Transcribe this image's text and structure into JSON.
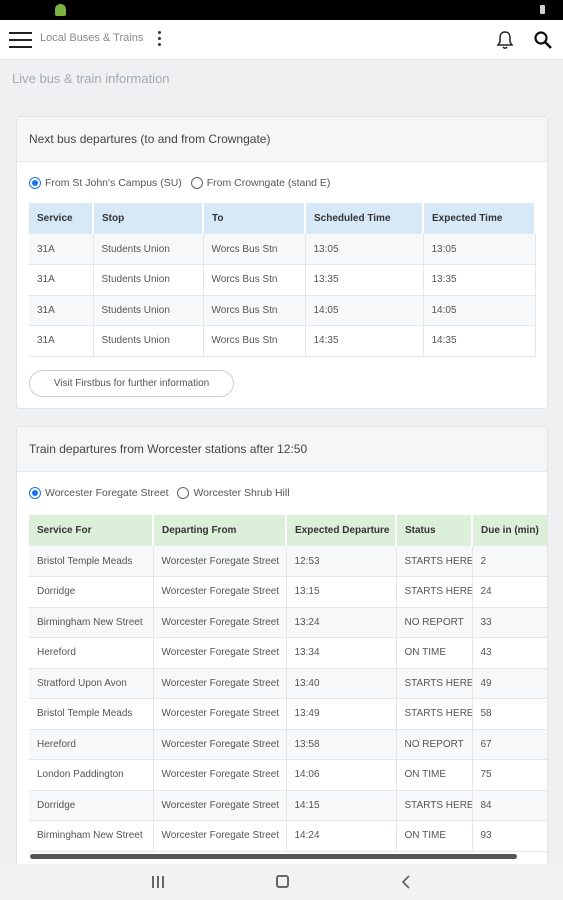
{
  "app": {
    "title": "Local Buses & Trains",
    "subtitle": "Live bus & train information",
    "icons": [
      "menu-icon",
      "more-vert-icon",
      "bell-icon",
      "search-icon"
    ]
  },
  "bus": {
    "header": "Next bus departures (to and from Crowngate)",
    "options": [
      "From St John's Campus (SU)",
      "From Crowngate (stand E)"
    ],
    "selected": 0,
    "columns": [
      "Service",
      "Stop",
      "To",
      "Scheduled Time",
      "Expected Time"
    ],
    "rows": [
      [
        "31A",
        "Students Union",
        "Worcs Bus Stn",
        "13:05",
        "13:05"
      ],
      [
        "31A",
        "Students Union",
        "Worcs Bus Stn",
        "13:35",
        "13:35"
      ],
      [
        "31A",
        "Students Union",
        "Worcs Bus Stn",
        "14:05",
        "14:05"
      ],
      [
        "31A",
        "Students Union",
        "Worcs Bus Stn",
        "14:35",
        "14:35"
      ]
    ],
    "button": "Visit Firstbus for further information"
  },
  "train": {
    "header": "Train departures from Worcester stations after 12:50",
    "options": [
      "Worcester Foregate Street",
      "Worcester Shrub Hill"
    ],
    "selected": 0,
    "columns": [
      "Service For",
      "Departing From",
      "Expected Departure",
      "Status",
      "Due in (min)"
    ],
    "rows": [
      [
        "Bristol Temple Meads",
        "Worcester Foregate Street",
        "12:53",
        "STARTS HERE",
        "2"
      ],
      [
        "Dorridge",
        "Worcester Foregate Street",
        "13:15",
        "STARTS HERE",
        "24"
      ],
      [
        "Birmingham New Street",
        "Worcester Foregate Street",
        "13:24",
        "NO REPORT",
        "33"
      ],
      [
        "Hereford",
        "Worcester Foregate Street",
        "13:34",
        "ON TIME",
        "43"
      ],
      [
        "Stratford Upon Avon",
        "Worcester Foregate Street",
        "13:40",
        "STARTS HERE",
        "49"
      ],
      [
        "Bristol Temple Meads",
        "Worcester Foregate Street",
        "13:49",
        "STARTS HERE",
        "58"
      ],
      [
        "Hereford",
        "Worcester Foregate Street",
        "13:58",
        "NO REPORT",
        "67"
      ],
      [
        "London Paddington",
        "Worcester Foregate Street",
        "14:06",
        "ON TIME",
        "75"
      ],
      [
        "Dorridge",
        "Worcester Foregate Street",
        "14:15",
        "STARTS HERE",
        "84"
      ],
      [
        "Birmingham New Street",
        "Worcester Foregate Street",
        "14:24",
        "ON TIME",
        "93"
      ]
    ]
  },
  "colors": {
    "bus_header_bg": "#d7e9f7",
    "train_header_bg": "#dcefd8",
    "radio_accent": "#1a73e8"
  }
}
